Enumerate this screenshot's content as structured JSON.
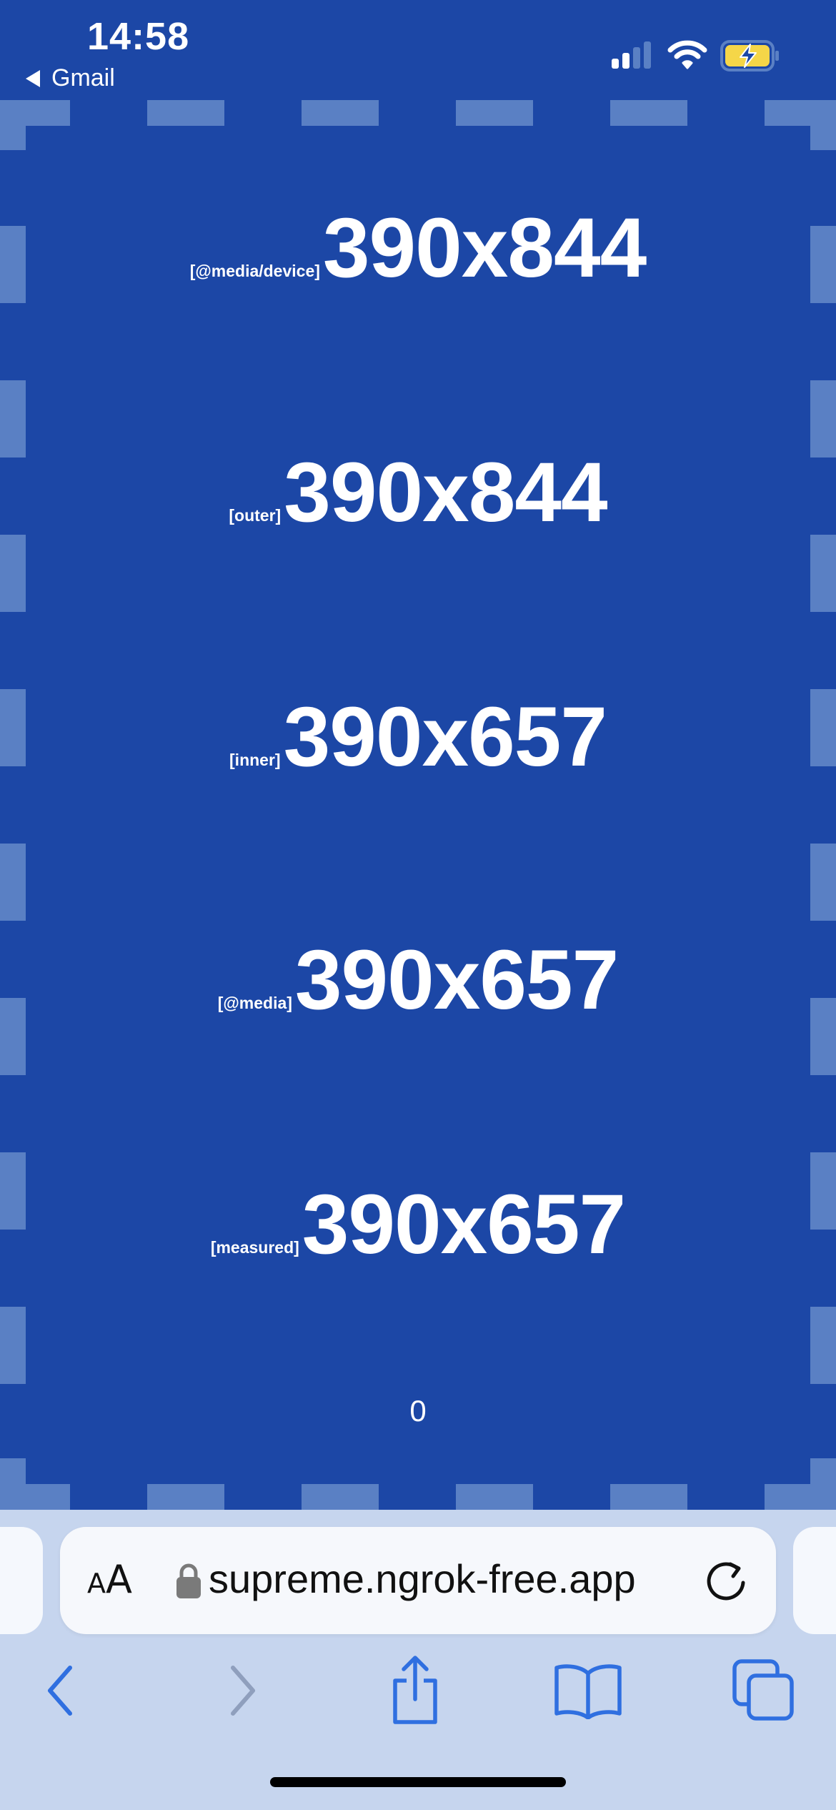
{
  "status_bar": {
    "time": "14:58",
    "back_label": "Gmail"
  },
  "measurements": [
    {
      "label": "[@media/device]",
      "value": "390x844"
    },
    {
      "label": "[outer]",
      "value": "390x844"
    },
    {
      "label": "[inner]",
      "value": "390x657"
    },
    {
      "label": "[@media]",
      "value": "390x657"
    },
    {
      "label": "[measured]",
      "value": "390x657"
    }
  ],
  "counter": "0",
  "safari": {
    "aa_small": "A",
    "aa_large": "A",
    "url": "supreme.ngrok-free.app"
  },
  "colors": {
    "page_background": "#1c47a6",
    "dash_color": "#5a80c4",
    "toolbar_background": "#c6d5ee",
    "toolbar_icon": "#2f6fe0",
    "battery_fill": "#f5d648"
  },
  "icons": {
    "signal": "cellular-signal-icon",
    "wifi": "wifi-icon",
    "battery": "battery-charging-icon",
    "lock": "lock-icon",
    "reload": "reload-icon",
    "back": "chevron-left-icon",
    "forward": "chevron-right-icon",
    "share": "share-icon",
    "bookmarks": "book-icon",
    "tabs": "tabs-icon"
  }
}
